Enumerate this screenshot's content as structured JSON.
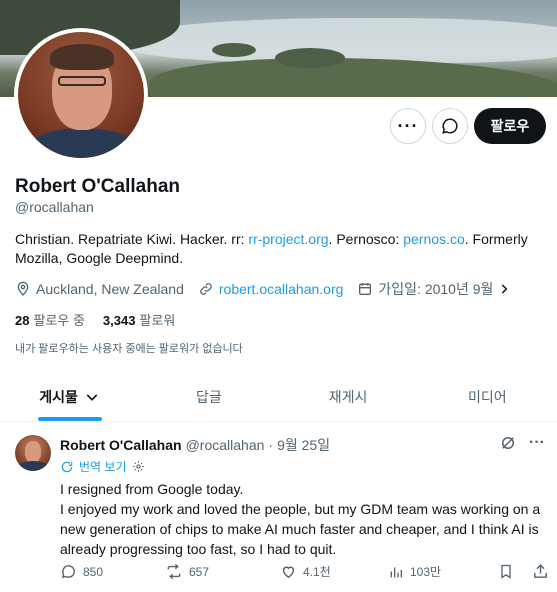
{
  "profile": {
    "name": "Robert O'Callahan",
    "handle": "@rocallahan",
    "follow_label": "팔로우",
    "bio": {
      "part1": "Christian. Repatriate Kiwi. Hacker. rr: ",
      "link1": "rr-project.org",
      "part2": ". Pernosco: ",
      "link2": "pernos.co",
      "part3": ". Formerly Mozilla, Google Deepmind."
    },
    "location": "Auckland, New Zealand",
    "website": "robert.ocallahan.org",
    "joined": "가입일: 2010년 9월",
    "following_count": "28",
    "following_label": "팔로우 중",
    "followers_count": "3,343",
    "followers_label": "팔로워",
    "followed_by_note": "내가 팔로우하는 사용자 중에는 팔로워가 없습니다"
  },
  "tabs": [
    {
      "label": "게시물"
    },
    {
      "label": "답글"
    },
    {
      "label": "재게시"
    },
    {
      "label": "미디어"
    }
  ],
  "post": {
    "author_name": "Robert O'Callahan",
    "author_handle": "@rocallahan",
    "separator": "·",
    "date": "9월 25일",
    "translate_label": "번역 보기",
    "text_line1": "I resigned from Google today.",
    "text_line2": "I enjoyed my work and loved the people, but my GDM team was working on a new generation of chips to make AI much faster and cheaper, and I think AI is already progressing too fast, so I had to quit.",
    "replies": "850",
    "reposts": "657",
    "likes": "4.1천",
    "views": "103만"
  },
  "colors": {
    "accent": "#1d9bf0",
    "text": "#0f1419",
    "secondary": "#536471",
    "follow_button": "#0f1419"
  }
}
